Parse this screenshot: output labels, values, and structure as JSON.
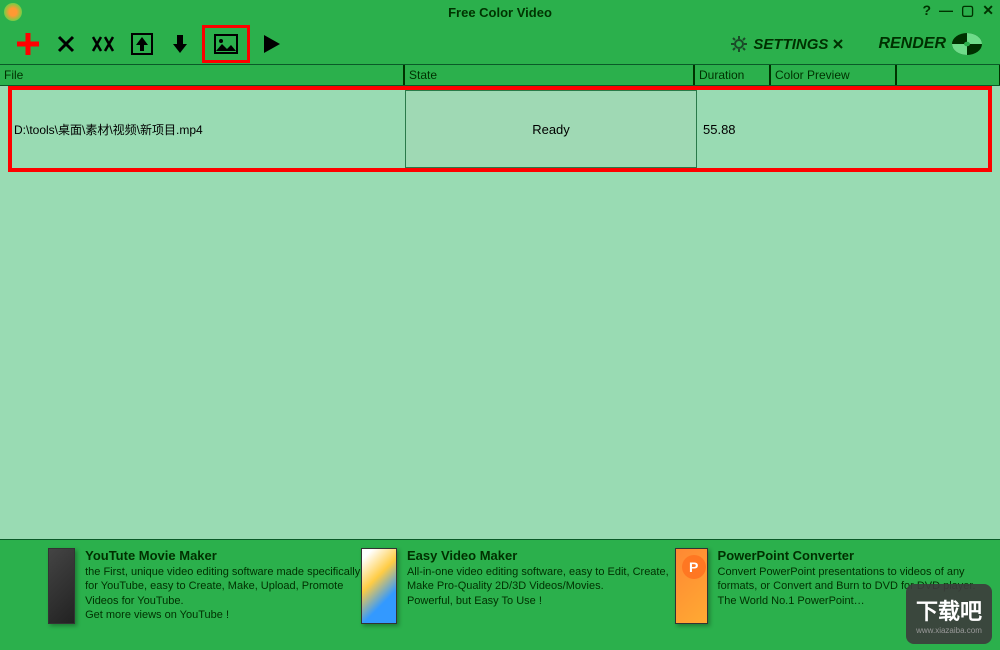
{
  "window": {
    "title": "Free Color Video"
  },
  "table": {
    "headers": {
      "file": "File",
      "state": "State",
      "duration": "Duration",
      "preview": "Color Preview"
    },
    "rows": [
      {
        "file": "D:\\tools\\桌面\\素材\\视频\\新项目.mp4",
        "state": "Ready",
        "duration": "55.88"
      }
    ]
  },
  "toolbar": {
    "settings_label": "SETTINGS",
    "render_label": "RENDER"
  },
  "promo": [
    {
      "title": "YouTute Movie Maker",
      "desc": "the First, unique video editing software made specifically for YouTube, easy to Create, Make, Upload, Promote Videos for YouTube.",
      "extra": "Get more views on YouTube !"
    },
    {
      "title": "Easy Video Maker",
      "desc": "All-in-one video editing software, easy to Edit, Create, Make Pro-Quality 2D/3D Videos/Movies.",
      "extra": "Powerful, but Easy To Use !"
    },
    {
      "title": "PowerPoint Converter",
      "desc": "Convert PowerPoint presentations to videos of any formats, or Convert and Burn to DVD for DVD player.",
      "extra": "The World No.1 PowerPoint…"
    }
  ],
  "watermark": {
    "line1": "下载吧",
    "line2": "www.xiazaiba.com"
  }
}
